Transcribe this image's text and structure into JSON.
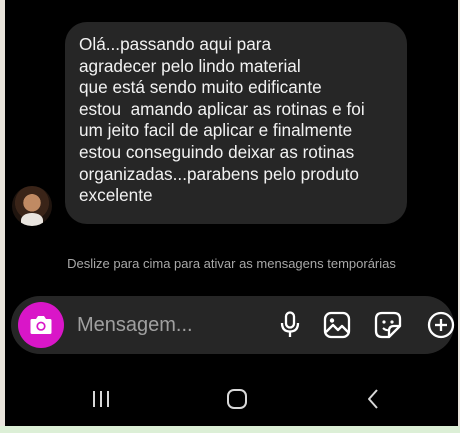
{
  "conversation": {
    "message": {
      "text": "Olá...passando aqui para\nagradecer pelo lindo material\nque está sendo muito edificante\nestou  amando aplicar as rotinas e foi\num jeito facil de aplicar e finalmente\nestou conseguindo deixar as rotinas\norganizadas...parabens pelo produto\nexcelente"
    },
    "hint": "Deslize para cima para ativar as mensagens temporárias"
  },
  "composer": {
    "placeholder": "Mensagem...",
    "accent_color": "#d916c8",
    "icons": [
      "camera-icon",
      "microphone-icon",
      "gallery-icon",
      "sticker-icon",
      "add-icon"
    ]
  },
  "navigation": {
    "icons": [
      "recent-apps-icon",
      "home-icon",
      "back-icon"
    ]
  }
}
